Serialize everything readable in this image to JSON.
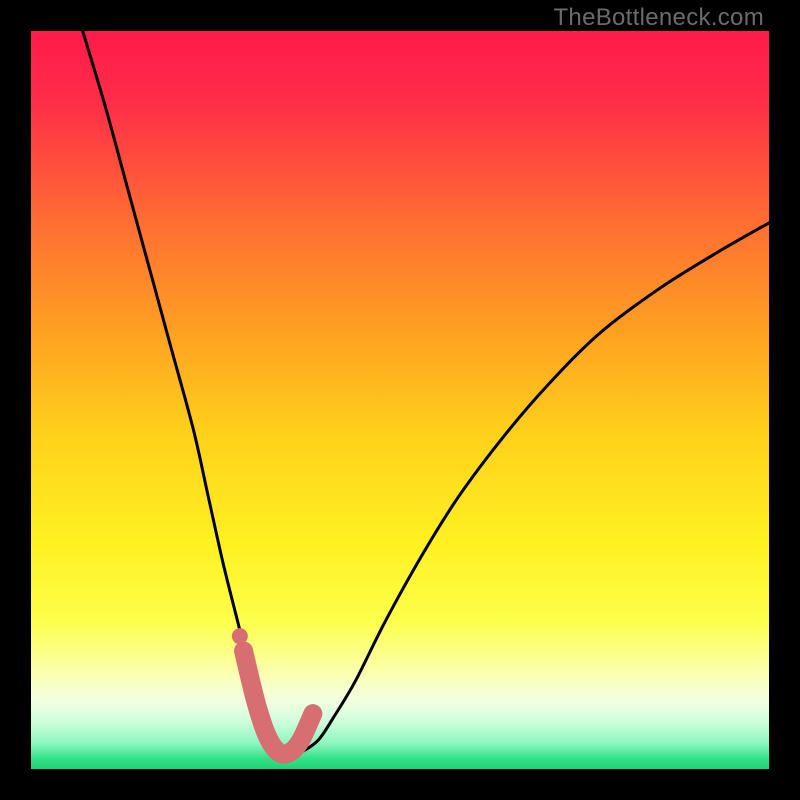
{
  "watermark": "TheBottleneck.com",
  "colors": {
    "frame": "#000000",
    "gradient_stops": [
      {
        "offset": 0.0,
        "color": "#ff1a4b"
      },
      {
        "offset": 0.1,
        "color": "#ff2e47"
      },
      {
        "offset": 0.25,
        "color": "#ff6a34"
      },
      {
        "offset": 0.4,
        "color": "#ff9e22"
      },
      {
        "offset": 0.55,
        "color": "#ffd21a"
      },
      {
        "offset": 0.7,
        "color": "#fff223"
      },
      {
        "offset": 0.8,
        "color": "#fdff4a"
      },
      {
        "offset": 0.87,
        "color": "#fbffb0"
      },
      {
        "offset": 0.905,
        "color": "#f4ffdf"
      },
      {
        "offset": 0.935,
        "color": "#cfffdc"
      },
      {
        "offset": 0.965,
        "color": "#8ef7c0"
      },
      {
        "offset": 0.985,
        "color": "#34e388"
      },
      {
        "offset": 1.0,
        "color": "#20d276"
      }
    ],
    "curve": "#000000",
    "marker_fill": "#d76f72",
    "marker_stroke": "#d76f72"
  },
  "chart_data": {
    "type": "line",
    "title": "",
    "xlabel": "",
    "ylabel": "",
    "xlim": [
      0,
      100
    ],
    "ylim": [
      0,
      100
    ],
    "grid": false,
    "series": [
      {
        "name": "bottleneck-curve",
        "x": [
          7,
          10,
          13,
          16,
          19,
          22,
          24,
          26,
          28,
          29.5,
          31,
          32.5,
          34,
          35.5,
          37,
          39,
          41,
          44,
          48,
          53,
          58,
          64,
          70,
          77,
          85,
          93,
          100
        ],
        "y": [
          100,
          90,
          79,
          68,
          57,
          46,
          37,
          28,
          20,
          14,
          9,
          5.5,
          3,
          2,
          2.5,
          4,
          7,
          12,
          20,
          29,
          37,
          45,
          52,
          59,
          65,
          70,
          74
        ]
      }
    ],
    "markers": {
      "name": "highlight-segment",
      "x": [
        28.8,
        30.5,
        32,
        33.5,
        35,
        36.5,
        38.2
      ],
      "y": [
        16,
        9,
        4.5,
        2.3,
        2.2,
        3.8,
        7.5
      ]
    },
    "single_marker": {
      "x": 28.3,
      "y": 18
    }
  }
}
